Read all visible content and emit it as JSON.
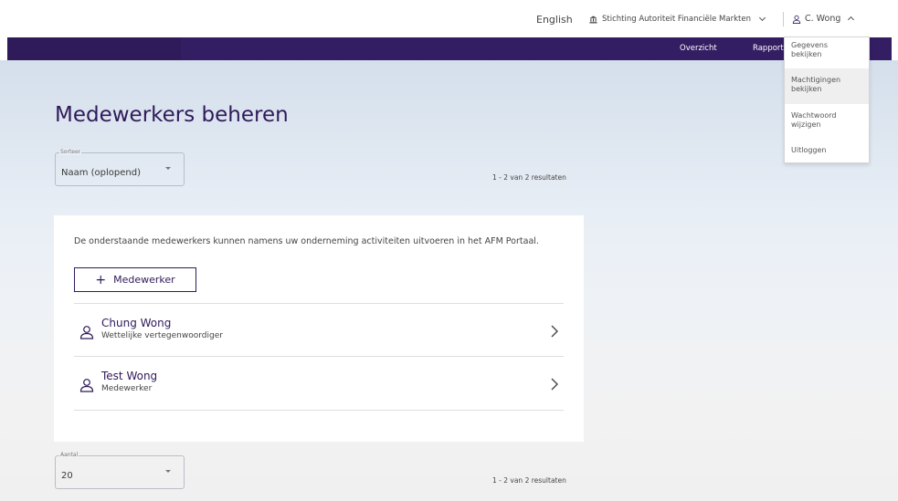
{
  "topbar": {
    "language": "English",
    "organization": "Stichting Autoriteit Financiële Markten",
    "user": "C. Wong"
  },
  "nav": {
    "items": [
      "Overzicht",
      "Rapport"
    ]
  },
  "user_menu": {
    "items": [
      {
        "line1": "Gegevens",
        "line2": "bekijken"
      },
      {
        "line1": "Machtigingen",
        "line2": "bekijken"
      },
      {
        "line1": "Wachtwoord",
        "line2": "wijzigen"
      },
      {
        "line1": "Uitloggen",
        "line2": ""
      }
    ]
  },
  "page": {
    "title": "Medewerkers beheren"
  },
  "sort": {
    "legend": "Sorteer",
    "value": "Naam (oplopend)"
  },
  "count": {
    "legend": "Aantal",
    "value": "20"
  },
  "results_text": "1 - 2 van 2 resultaten",
  "card": {
    "intro": "De onderstaande medewerkers kunnen namens uw onderneming activiteiten uitvoeren in het AFM Portaal.",
    "add_button": "Medewerker",
    "people": [
      {
        "name": "Chung Wong",
        "role": "Wettelijke vertegenwoordiger"
      },
      {
        "name": "Test Wong",
        "role": "Medewerker"
      }
    ]
  },
  "colors": {
    "brand_purple": "#2f1a5a",
    "nav_purple": "#331d63"
  },
  "icons": {
    "organization": "bank-building-icon",
    "user": "person-icon",
    "person_row": "person-icon",
    "row_action": "chevron-right-icon"
  }
}
